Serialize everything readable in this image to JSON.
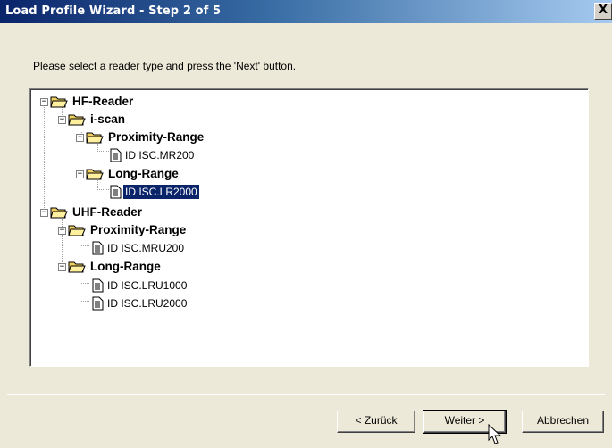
{
  "window": {
    "title": "Load Profile Wizard - Step 2 of 5",
    "close_label": "X"
  },
  "instruction": "Please select a reader type and press the 'Next' button.",
  "tree": {
    "expander_symbol": "−",
    "nodes": [
      {
        "label": "HF-Reader"
      },
      {
        "label": "i-scan"
      },
      {
        "label": "Proximity-Range"
      },
      {
        "label": "ID ISC.MR200"
      },
      {
        "label": "Long-Range"
      },
      {
        "label": "ID ISC.LR2000",
        "selected": true
      },
      {
        "label": "UHF-Reader"
      },
      {
        "label": "Proximity-Range"
      },
      {
        "label": "ID ISC.MRU200"
      },
      {
        "label": "Long-Range"
      },
      {
        "label": "ID ISC.LRU1000"
      },
      {
        "label": "ID ISC.LRU2000"
      }
    ]
  },
  "buttons": {
    "back": "< Zurück",
    "next": "Weiter >",
    "cancel": "Abbrechen"
  },
  "colors": {
    "selection": "#0a246a",
    "folder": "#f0d060",
    "title_gradient_start": "#0a246a"
  }
}
